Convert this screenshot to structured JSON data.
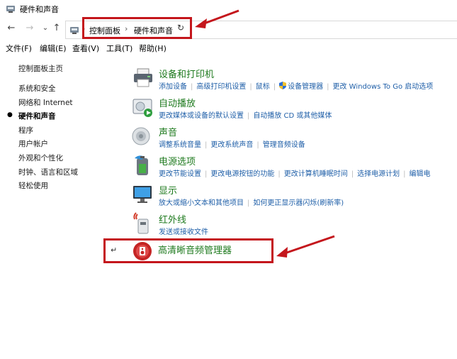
{
  "window": {
    "title": "硬件和声音"
  },
  "address": {
    "segments": [
      "控制面板",
      "硬件和声音"
    ],
    "separator": "›",
    "refresh": "↻"
  },
  "nav": {
    "back": "←",
    "forward": "→",
    "recent": "⌄",
    "up": "↑"
  },
  "menu": [
    "文件(F)",
    "编辑(E)",
    "查看(V)",
    "工具(T)",
    "帮助(H)"
  ],
  "sidebar": {
    "home": "控制面板主页",
    "items": [
      "系统和安全",
      "网络和 Internet",
      "硬件和声音",
      "程序",
      "用户帐户",
      "外观和个性化",
      "时钟、语言和区域",
      "轻松使用"
    ],
    "active_index": 2
  },
  "categories": [
    {
      "title": "设备和打印机",
      "icon": "printer-icon",
      "links": [
        "添加设备",
        "高级打印机设置",
        "鼠标",
        "设备管理器",
        "更改 Windows To Go 启动选项"
      ]
    },
    {
      "title": "自动播放",
      "icon": "autoplay-icon",
      "links": [
        "更改媒体或设备的默认设置",
        "自动播放 CD 或其他媒体"
      ]
    },
    {
      "title": "声音",
      "icon": "speaker-icon",
      "links": [
        "调整系统音量",
        "更改系统声音",
        "管理音频设备"
      ]
    },
    {
      "title": "电源选项",
      "icon": "battery-icon",
      "links": [
        "更改节能设置",
        "更改电源按钮的功能",
        "更改计算机睡眠时间",
        "选择电源计划",
        "编辑电"
      ]
    },
    {
      "title": "显示",
      "icon": "monitor-icon",
      "links": [
        "放大或缩小文本和其他项目",
        "如何更正显示器闪烁(刷新率)"
      ]
    },
    {
      "title": "红外线",
      "icon": "infrared-icon",
      "links": [
        "发送或接收文件"
      ]
    }
  ],
  "hd_audio": {
    "title": "高清晰音频管理器",
    "icon": "hd-audio-icon",
    "mark": "↵"
  },
  "colors": {
    "link": "#1f5fa8",
    "title": "#1e7a1e",
    "annotation": "#c4161c"
  }
}
